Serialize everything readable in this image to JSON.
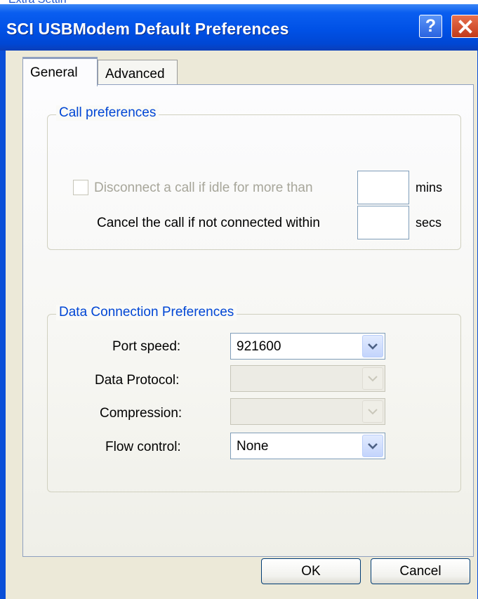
{
  "background_text": "Extra Settin",
  "window": {
    "title": "SCI USBModem Default Preferences",
    "help_glyph": "?",
    "close_glyph": "✕"
  },
  "tabs": [
    {
      "label": "General",
      "active": true
    },
    {
      "label": "Advanced",
      "active": false
    }
  ],
  "call_preferences": {
    "legend": "Call preferences",
    "disconnect_label": "Disconnect a call if idle for more than",
    "disconnect_checked": false,
    "disconnect_enabled": false,
    "disconnect_value": "",
    "disconnect_unit": "mins",
    "cancel_label": "Cancel the call if not connected within",
    "cancel_value": "",
    "cancel_unit": "secs"
  },
  "data_connection": {
    "legend": "Data Connection Preferences",
    "port_speed_label": "Port speed:",
    "port_speed_value": "921600",
    "data_protocol_label": "Data Protocol:",
    "data_protocol_value": "",
    "compression_label": "Compression:",
    "compression_value": "",
    "flow_control_label": "Flow control:",
    "flow_control_value": "None"
  },
  "buttons": {
    "ok": "OK",
    "cancel": "Cancel"
  },
  "colors": {
    "titlebar": "#0051e6",
    "legend_text": "#0046d5",
    "disabled_text": "#a7a69a",
    "active_tab_accent": "#f0a028",
    "close_button": "#c23a1a"
  }
}
